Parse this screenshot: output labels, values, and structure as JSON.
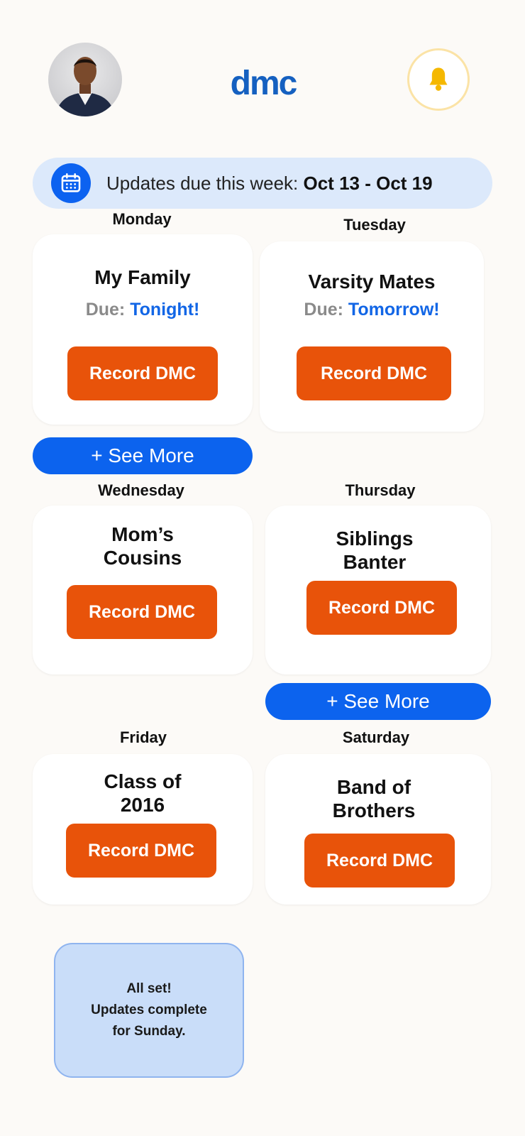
{
  "header": {
    "logo_text": "dmc"
  },
  "banner": {
    "prefix": "Updates due this week: ",
    "range": "Oct 13 - Oct 19"
  },
  "days": [
    {
      "day": "Monday",
      "group": "My Family",
      "due_label": "Due: ",
      "due_value": "Tonight!",
      "button": "Record DMC"
    },
    {
      "day": "Tuesday",
      "group": "Varsity Mates",
      "due_label": "Due: ",
      "due_value": "Tomorrow!",
      "button": "Record DMC"
    },
    {
      "day": "Wednesday",
      "group_line1": "Mom’s",
      "group_line2": "Cousins",
      "button": "Record DMC"
    },
    {
      "day": "Thursday",
      "group_line1": "Siblings",
      "group_line2": "Banter",
      "button": "Record DMC"
    },
    {
      "day": "Friday",
      "group_line1": "Class of",
      "group_line2": "2016",
      "button": "Record DMC"
    },
    {
      "day": "Saturday",
      "group_line1": "Band of",
      "group_line2": "Brothers",
      "button": "Record DMC"
    }
  ],
  "see_more": [
    "+ See More",
    "+ See More"
  ],
  "status": {
    "line1": "All set!",
    "line2": "Updates complete",
    "line3": "for Sunday."
  },
  "colors": {
    "accent_blue": "#0c63ee",
    "record_orange": "#e8530a",
    "bell_yellow": "#f5b800",
    "background": "#fcfaf7"
  },
  "icons": {
    "calendar": "calendar-icon",
    "bell": "bell-icon",
    "avatar": "profile-avatar"
  }
}
